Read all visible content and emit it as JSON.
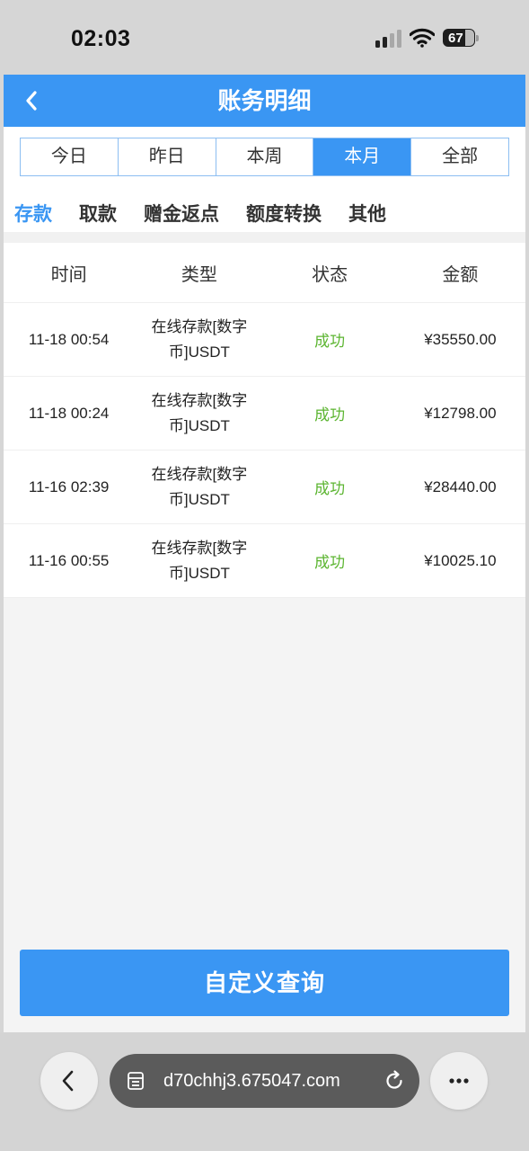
{
  "status_bar": {
    "time": "02:03",
    "battery": "67",
    "icons": [
      "signal-icon",
      "wifi-icon",
      "battery-icon"
    ]
  },
  "header": {
    "title": "账务明细",
    "back_icon": "chevron-left-icon"
  },
  "period_tabs": [
    {
      "label": "今日",
      "active": false
    },
    {
      "label": "昨日",
      "active": false
    },
    {
      "label": "本周",
      "active": false
    },
    {
      "label": "本月",
      "active": true
    },
    {
      "label": "全部",
      "active": false
    }
  ],
  "category_tabs": [
    {
      "label": "存款",
      "active": true
    },
    {
      "label": "取款",
      "active": false
    },
    {
      "label": "赠金返点",
      "active": false
    },
    {
      "label": "额度转换",
      "active": false
    },
    {
      "label": "其他",
      "active": false
    }
  ],
  "table": {
    "columns": [
      "时间",
      "类型",
      "状态",
      "金额"
    ],
    "rows": [
      {
        "time": "11-18 00:54",
        "type": "在线存款[数字币]USDT",
        "status": "成功",
        "amount": "¥35550.00"
      },
      {
        "time": "11-18 00:24",
        "type": "在线存款[数字币]USDT",
        "status": "成功",
        "amount": "¥12798.00"
      },
      {
        "time": "11-16 02:39",
        "type": "在线存款[数字币]USDT",
        "status": "成功",
        "amount": "¥28440.00"
      },
      {
        "time": "11-16 00:55",
        "type": "在线存款[数字币]USDT",
        "status": "成功",
        "amount": "¥10025.10"
      }
    ]
  },
  "query_button": {
    "label": "自定义查询"
  },
  "browser_bar": {
    "url": "d70chhj3.675047.com",
    "icons": [
      "back-icon",
      "reader-icon",
      "reload-icon",
      "more-icon"
    ]
  },
  "colors": {
    "primary": "#3a96f3",
    "success": "#5cb531"
  }
}
